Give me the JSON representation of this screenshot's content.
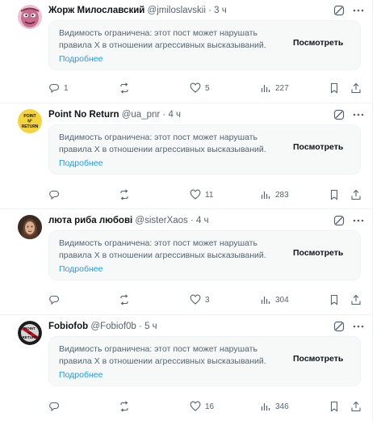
{
  "feed": {
    "posts": [
      {
        "display_name": "Жорж Милославский",
        "handle": "@jmiloslavskii",
        "separator": "·",
        "time": "3 ч",
        "avatar": "cartoon-face-pink",
        "notice_text": "Видимость ограничена: этот пост может нарушать правила X в отношении агрессивных высказываний.",
        "notice_link": "Подробнее",
        "notice_button": "Посмотреть",
        "replies": "1",
        "reposts": "",
        "likes": "5",
        "views": "227"
      },
      {
        "display_name": "Point No Return",
        "handle": "@ua_pnr",
        "separator": "·",
        "time": "4 ч",
        "avatar": "yellow-badge",
        "avatar_text": [
          "POINT",
          "N°",
          "RETURN"
        ],
        "notice_text": "Видимость ограничена: этот пост может нарушать правила X в отношении агрессивных высказываний.",
        "notice_link": "Подробнее",
        "notice_button": "Посмотреть",
        "replies": "",
        "reposts": "",
        "likes": "11",
        "views": "283"
      },
      {
        "display_name": "люта риба любові",
        "handle": "@sisterXaos",
        "separator": "·",
        "time": "4 ч",
        "avatar": "dark-portrait",
        "notice_text": "Видимость ограничена: этот пост может нарушать правила X в отношении агрессивных высказываний.",
        "notice_link": "Подробнее",
        "notice_button": "Посмотреть",
        "replies": "",
        "reposts": "",
        "likes": "3",
        "views": "304"
      },
      {
        "display_name": "Fobiofob",
        "handle": "@Fobiof0b",
        "separator": "·",
        "time": "5 ч",
        "avatar": "black-red-badge",
        "avatar_text": [
          "POINT",
          "N°",
          "RETURN"
        ],
        "notice_text": "Видимость ограничена: этот пост может нарушать правила X в отношении агрессивных высказываний.",
        "notice_link": "Подробнее",
        "notice_button": "Посмотреть",
        "replies": "",
        "reposts": "",
        "likes": "16",
        "views": "346"
      }
    ]
  },
  "colors": {
    "text_primary": "#0f1419",
    "text_secondary": "#536471",
    "link": "#1d9bf0",
    "notice_bg": "#f7f9f9",
    "border": "#eff3f4"
  },
  "icons": [
    "grok-icon",
    "more-icon",
    "reply-icon",
    "repost-icon",
    "like-icon",
    "views-icon",
    "bookmark-icon",
    "share-icon"
  ]
}
